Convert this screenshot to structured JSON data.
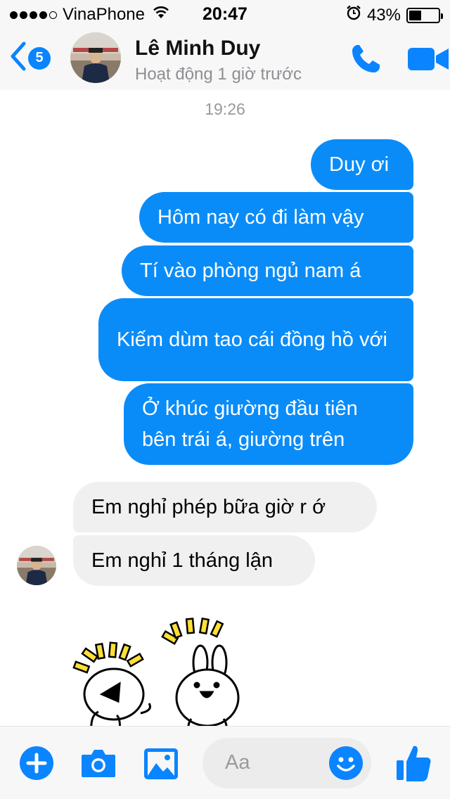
{
  "status_bar": {
    "carrier": "VinaPhone",
    "time": "20:47",
    "battery": "43%",
    "battery_level": 0.43
  },
  "header": {
    "unread_count": "5",
    "contact_name": "Lê Minh Duy",
    "contact_status": "Hoạt động 1 giờ trước",
    "call_icon": "phone-icon",
    "video_icon": "video-camera-icon"
  },
  "thread": {
    "timestamp": "19:26",
    "messages": [
      {
        "direction": "outgoing",
        "text": "Duy ơi"
      },
      {
        "direction": "outgoing",
        "text": "Hôm nay có đi làm vậy"
      },
      {
        "direction": "outgoing",
        "text": "Tí vào phòng ngủ nam á"
      },
      {
        "direction": "outgoing",
        "text": "Kiếm dùm tao cái đồng hồ với"
      },
      {
        "direction": "outgoing",
        "text": "Ở khúc giường đầu tiên bên trái á, giường trên"
      },
      {
        "direction": "incoming",
        "text": "Em nghỉ phép bữa giờ r ớ"
      },
      {
        "direction": "incoming",
        "text": "Em nghỉ 1 tháng lận"
      }
    ],
    "sticker": "cheering-rabbit-sticker"
  },
  "composer": {
    "placeholder": "Aa",
    "icons": [
      "plus-icon",
      "camera-icon",
      "gallery-icon",
      "emoji-icon",
      "thumbs-up-icon"
    ]
  },
  "colors": {
    "accent": "#0a84ff",
    "outgoing_bubble": "#0a8cf8",
    "incoming_bubble": "#f1f0f0"
  }
}
